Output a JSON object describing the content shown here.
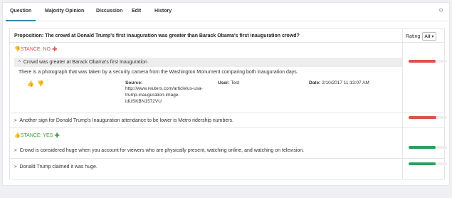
{
  "tabs": [
    {
      "label": "Question"
    },
    {
      "label": "Majority Opinion"
    },
    {
      "label": "Discussion"
    },
    {
      "label": "Edit"
    },
    {
      "label": "History"
    }
  ],
  "proposition": "Proposition: The crowd at Donald Trump's first inauguration was greater than Barack Obama's first inauguration crowd?",
  "rating": {
    "label": "Rating",
    "selected": "All"
  },
  "stance_no": {
    "label": "STANCE: NO",
    "color": "#d9534f"
  },
  "stance_yes": {
    "label": "STANCE: YES",
    "color": "#3c9a3c"
  },
  "reasons": [
    {
      "text": "Crowd was greater at Barack Obama's first Inauguration",
      "caret": "^",
      "detail": "There is a photograph that was taken by a security camera from the Washington Monument comparing both inauguration days.",
      "source_label": "Source:",
      "source_lines": [
        "http://www.reuters.com/article/us-usa-",
        "trump-inauguration-image-",
        "idUSKBN1572VU"
      ],
      "user_label": "User:",
      "user": "Test",
      "date_label": "Date:",
      "date": "2/10/2017 11:13:07 AM",
      "rating_fill": 0.7,
      "rating_color": "#d9534f"
    },
    {
      "text": "Another sign for Donald Trump's Inauguration attendance to be lower is Metro ridership numbers.",
      "caret": ">",
      "rating_fill": 0.72,
      "rating_color": "#d9534f"
    },
    {
      "text": "Crowd is considered huge when you account for viewers who are physically present, watching online, and watching on television.",
      "caret": ">",
      "rating_fill": 0.7,
      "rating_color": "#2e9e5e"
    },
    {
      "text": "Donald Trump claimed it was huge.",
      "caret": ">",
      "rating_fill": 0.7,
      "rating_color": "#2e9e5e"
    }
  ]
}
